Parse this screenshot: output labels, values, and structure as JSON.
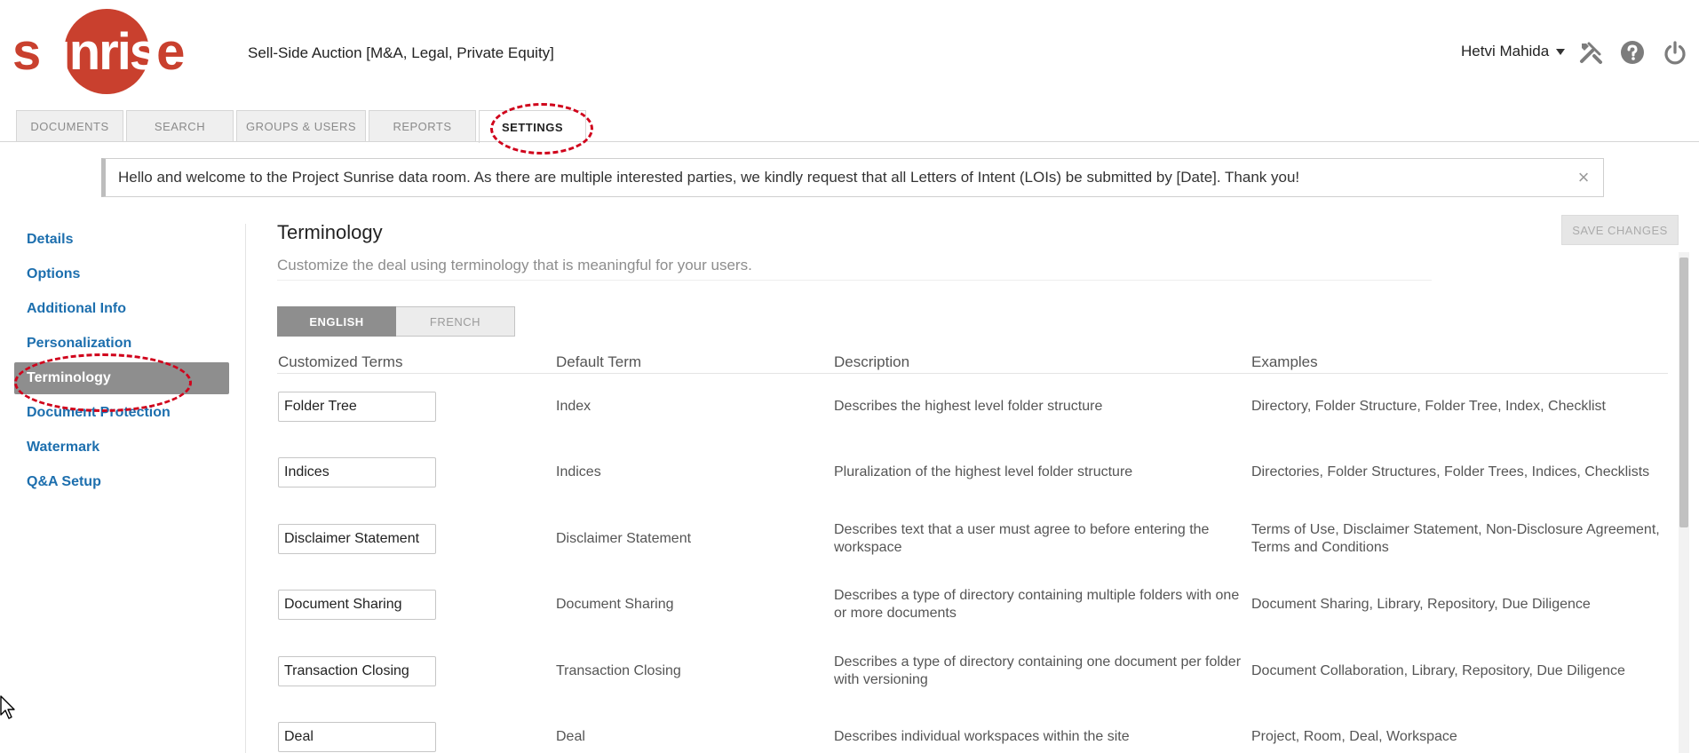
{
  "logo": {
    "pre": "s",
    "inside": "unris",
    "post": "e"
  },
  "deal_title": "Sell-Side Auction [M&A, Legal, Private Equity]",
  "user": {
    "name": "Hetvi Mahida"
  },
  "header_icons": [
    "tools-icon",
    "help-icon",
    "power-icon"
  ],
  "tabs": [
    {
      "label": "DOCUMENTS"
    },
    {
      "label": "SEARCH"
    },
    {
      "label": "GROUPS & USERS"
    },
    {
      "label": "REPORTS"
    },
    {
      "label": "SETTINGS",
      "active": true
    }
  ],
  "banner": {
    "text": "Hello and welcome to the Project Sunrise data room. As there are multiple interested parties, we kindly request that all Letters of Intent (LOIs) be submitted by [Date]. Thank you!",
    "close": "×"
  },
  "sidebar": {
    "items": [
      {
        "label": "Details"
      },
      {
        "label": "Options"
      },
      {
        "label": "Additional Info"
      },
      {
        "label": "Personalization"
      },
      {
        "label": "Terminology",
        "active": true
      },
      {
        "label": "Document Protection"
      },
      {
        "label": "Watermark"
      },
      {
        "label": "Q&A Setup"
      }
    ]
  },
  "section": {
    "title": "Terminology",
    "subtitle": "Customize the deal using terminology that is meaningful for your users.",
    "save_label": "SAVE CHANGES"
  },
  "languages": [
    {
      "label": "ENGLISH",
      "active": true
    },
    {
      "label": "FRENCH",
      "active": false
    }
  ],
  "table": {
    "headers": [
      "Customized Terms",
      "Default Term",
      "Description",
      "Examples"
    ],
    "rows": [
      {
        "custom": "Folder Tree",
        "default": "Index",
        "description": "Describes the highest level folder structure",
        "examples": "Directory, Folder Structure, Folder Tree, Index, Checklist"
      },
      {
        "custom": "Indices",
        "default": "Indices",
        "description": "Pluralization of the highest level folder structure",
        "examples": "Directories, Folder Structures, Folder Trees, Indices, Checklists"
      },
      {
        "custom": "Disclaimer Statement",
        "default": "Disclaimer Statement",
        "description": "Describes text that a user must agree to before entering the workspace",
        "examples": "Terms of Use, Disclaimer Statement, Non-Disclosure Agreement, Terms and Conditions"
      },
      {
        "custom": "Document Sharing",
        "default": "Document Sharing",
        "description": "Describes a type of directory containing multiple folders with one or more documents",
        "examples": "Document Sharing, Library, Repository, Due Diligence"
      },
      {
        "custom": "Transaction Closing",
        "default": "Transaction Closing",
        "description": "Describes a type of directory containing one document per folder with versioning",
        "examples": "Document Collaboration, Library, Repository, Due Diligence"
      },
      {
        "custom": "Deal",
        "default": "Deal",
        "description": "Describes individual workspaces within the site",
        "examples": "Project, Room, Deal, Workspace"
      }
    ]
  },
  "colors": {
    "brand": "#c9402e",
    "link": "#1d6fae",
    "annotation": "#d0021b",
    "active_gray": "#8e8e8e"
  }
}
